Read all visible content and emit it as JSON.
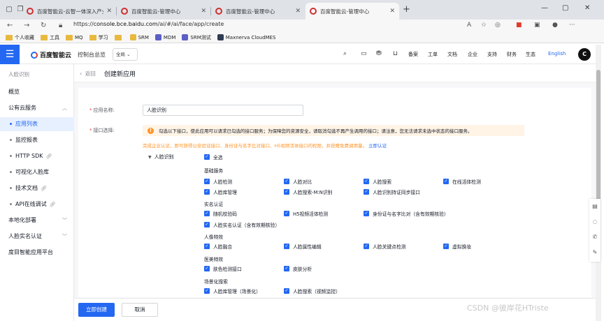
{
  "browser": {
    "tabs": [
      {
        "title": "百度智能云-云智一体深入产业"
      },
      {
        "title": "百度智能云-管理中心"
      },
      {
        "title": "百度智能云-管理中心"
      },
      {
        "title": "百度智能云-管理中心"
      }
    ],
    "url_prefix": "https://",
    "url_host": "console.bce.baidu.com",
    "url_path": "/ai/#/ai/face/app/create",
    "bookmarks": [
      {
        "label": "个人收藏",
        "type": "folder"
      },
      {
        "label": "工具",
        "type": "folder"
      },
      {
        "label": "MQ",
        "type": "folder"
      },
      {
        "label": "学习",
        "type": "folder"
      },
      {
        "label": "",
        "type": "folder"
      },
      {
        "label": "SRM",
        "type": "icon",
        "color": "#e8b93e"
      },
      {
        "label": "MDM",
        "type": "icon",
        "color": "#5b5fc7"
      },
      {
        "label": "SRM测试",
        "type": "icon",
        "color": "#5b5fc7"
      },
      {
        "label": "Maxnerva CloudMES",
        "type": "icon",
        "color": "#2f3b52"
      }
    ]
  },
  "header": {
    "logo": "百度智能云",
    "console": "控制台总览",
    "region": "全局",
    "links": [
      "备案",
      "工单",
      "文档",
      "企业",
      "支持",
      "财务",
      "生态"
    ],
    "lang": "English",
    "avatar": "C"
  },
  "sidebar": {
    "title": "人脸识别",
    "items": [
      {
        "label": "概览",
        "type": "top"
      },
      {
        "label": "公有云服务",
        "type": "group",
        "arrow": "︿"
      },
      {
        "label": "应用列表",
        "type": "sub",
        "active": true
      },
      {
        "label": "监控报表",
        "type": "sub"
      },
      {
        "label": "HTTP SDK",
        "type": "sub",
        "ext": true
      },
      {
        "label": "可视化人脸库",
        "type": "sub"
      },
      {
        "label": "技术文档",
        "type": "sub",
        "ext": true
      },
      {
        "label": "API在线调试",
        "type": "sub",
        "ext": true
      },
      {
        "label": "本地化部署",
        "type": "group",
        "arrow": "﹀"
      },
      {
        "label": "人脸实名认证",
        "type": "group",
        "arrow": "﹀"
      },
      {
        "label": "度目智能应用平台",
        "type": "top"
      }
    ]
  },
  "page": {
    "back": "返回",
    "title": "创建新应用",
    "app_name_label": "应用名称:",
    "app_name_value": "人脸识别",
    "api_label": "接口选择:",
    "warning": "勾选以下接口，使此应用可以请求已勾选的接口服务；为保障您的资源安全，请取消勾选不再产生调用的接口；请注意，您无法请求未选中状态的接口服务。",
    "auth_note": "完成企业认证，即可获得公安验证接口、身份证与名字比对接口、H5视频活体接口的权限，并获赠免费调用量。",
    "auth_link": "立即认证",
    "tree_root": "人脸识别",
    "select_all": "全选",
    "groups": [
      {
        "name": "基础服务",
        "items": [
          "人脸检测",
          "人脸对比",
          "人脸搜索",
          "在线活体检测",
          "人脸库管理",
          "人脸搜索-M:N识别",
          "人脸识别持证同步接口"
        ]
      },
      {
        "name": "实名认证",
        "items": [
          "随机校验码",
          "H5视频活体检测",
          "身份证与名字比对（含有效期核验）",
          "人脸实名认证（含有效期核验）"
        ]
      },
      {
        "name": "人像特效",
        "items": [
          "人脸融合",
          "人脸属性编辑",
          "人脸关键点检测",
          "虚拟换妆"
        ]
      },
      {
        "name": "医美特效",
        "items": [
          "肤色检测接口",
          "皮肤分析"
        ]
      },
      {
        "name": "场景化搜索",
        "items": [
          "人脸库管理（场景化）",
          "人脸搜索（视频监控）"
        ]
      }
    ]
  },
  "footer": {
    "create": "立即创建",
    "cancel": "取消"
  },
  "watermark": "CSDN @彼岸花HTriste"
}
